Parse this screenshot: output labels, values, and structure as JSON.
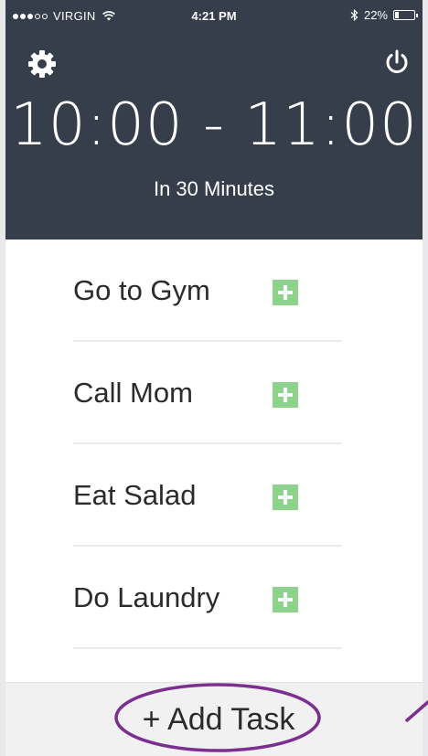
{
  "status_bar": {
    "carrier": "VIRGIN",
    "signal_bars_filled": 3,
    "signal_bars_total": 5,
    "time": "4:21 PM",
    "battery_percent": "22%",
    "battery_level": 0.22
  },
  "header": {
    "settings_icon": "gear-icon",
    "power_icon": "power-icon",
    "time_range": "10:00 - 11:00",
    "countdown": "In 30 Minutes"
  },
  "tasks": [
    {
      "label": "Go to Gym"
    },
    {
      "label": "Call Mom"
    },
    {
      "label": "Eat Salad"
    },
    {
      "label": "Do Laundry"
    }
  ],
  "footer": {
    "add_task_label": "+ Add Task"
  },
  "colors": {
    "header_bg": "#353e4a",
    "accent_green": "#8dd28a",
    "annotation_purple": "#7b2f8e"
  }
}
